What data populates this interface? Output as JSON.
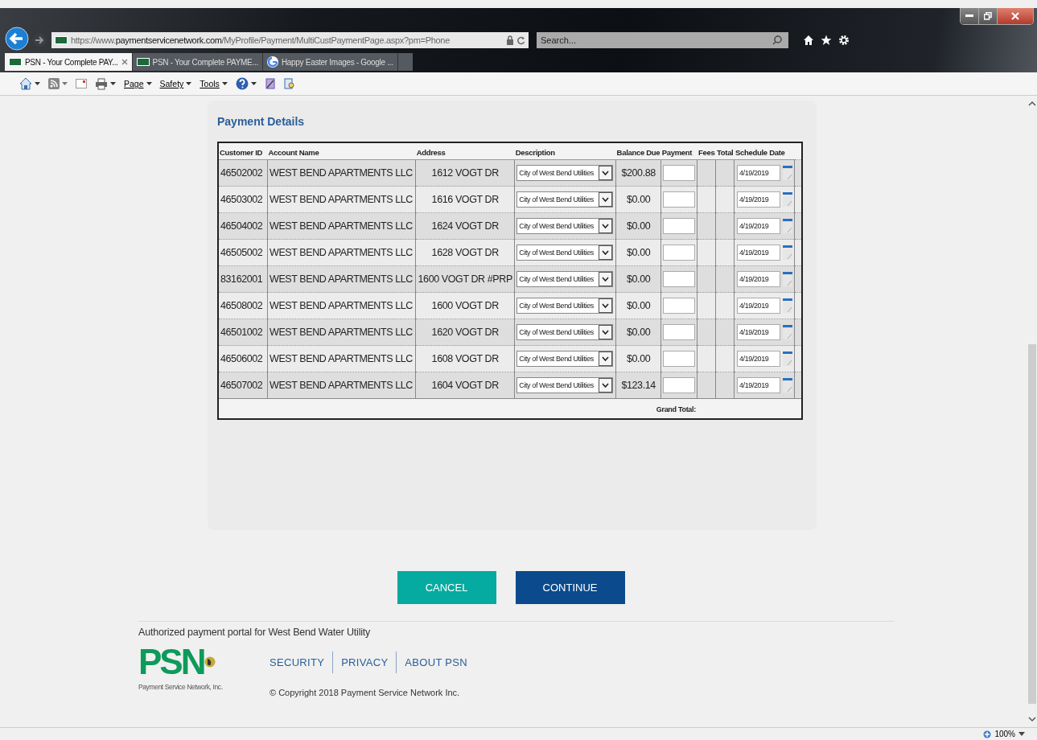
{
  "browser": {
    "address": "https://www.**paymentservicenetwork.com**/MyProfile/Payment/MultiCustPaymentPage.aspx?pm=Phone",
    "search": {
      "placeholder": "Search..."
    },
    "tabs": [
      {
        "title": "PSN - Your Complete PAY...",
        "selected": true
      },
      {
        "title": "PSN - Your Complete PAYME...",
        "selected": false
      },
      {
        "title": "Happy Easter Images - Google ...",
        "selected": false
      }
    ],
    "command_bar": [
      "Page",
      "Safety",
      "Tools"
    ],
    "zoom": "100%"
  },
  "payment_details": {
    "title": "Payment Details",
    "columns": [
      "Customer ID",
      "Account Name",
      "Address",
      "Description",
      "Balance Due",
      "Payment",
      "Fees",
      "Total",
      "Schedule Date"
    ],
    "rows": [
      {
        "customer_id": "46502002",
        "account_name": "WEST BEND APARTMENTS LLC",
        "address": "1612 VOGT DR",
        "description": "City of West Bend Utilities",
        "balance_due": "$200.88",
        "schedule_date": "4/19/2019"
      },
      {
        "customer_id": "46503002",
        "account_name": "WEST BEND APARTMENTS LLC",
        "address": "1616 VOGT DR",
        "description": "City of West Bend Utilities",
        "balance_due": "$0.00",
        "schedule_date": "4/19/2019"
      },
      {
        "customer_id": "46504002",
        "account_name": "WEST BEND APARTMENTS LLC",
        "address": "1624 VOGT DR",
        "description": "City of West Bend Utilities",
        "balance_due": "$0.00",
        "schedule_date": "4/19/2019"
      },
      {
        "customer_id": "46505002",
        "account_name": "WEST BEND APARTMENTS LLC",
        "address": "1628 VOGT DR",
        "description": "City of West Bend Utilities",
        "balance_due": "$0.00",
        "schedule_date": "4/19/2019"
      },
      {
        "customer_id": "83162001",
        "account_name": "WEST BEND APARTMENTS LLC",
        "address": "1600 VOGT DR #PRP",
        "description": "City of West Bend Utilities",
        "balance_due": "$0.00",
        "schedule_date": "4/19/2019"
      },
      {
        "customer_id": "46508002",
        "account_name": "WEST BEND APARTMENTS LLC",
        "address": "1600 VOGT DR",
        "description": "City of West Bend Utilities",
        "balance_due": "$0.00",
        "schedule_date": "4/19/2019"
      },
      {
        "customer_id": "46501002",
        "account_name": "WEST BEND APARTMENTS LLC",
        "address": "1620 VOGT DR",
        "description": "City of West Bend Utilities",
        "balance_due": "$0.00",
        "schedule_date": "4/19/2019"
      },
      {
        "customer_id": "46506002",
        "account_name": "WEST BEND APARTMENTS LLC",
        "address": "1608 VOGT DR",
        "description": "City of West Bend Utilities",
        "balance_due": "$0.00",
        "schedule_date": "4/19/2019"
      },
      {
        "customer_id": "46507002",
        "account_name": "WEST BEND APARTMENTS LLC",
        "address": "1604 VOGT DR",
        "description": "City of West Bend Utilities",
        "balance_due": "$123.14",
        "schedule_date": "4/19/2019"
      }
    ],
    "grand_total_label": "Grand Total:"
  },
  "buttons": [
    {
      "label": "CANCEL",
      "kind": "secondary"
    },
    {
      "label": "CONTINUE",
      "kind": "primary"
    }
  ],
  "footer": {
    "authorized": "Authorized payment portal for West Bend Water Utility",
    "logo_text": "PSN",
    "logo_caption": "Payment Service Network, Inc.",
    "links": [
      "SECURITY",
      "PRIVACY",
      "ABOUT PSN"
    ],
    "copyright": "© Copyright 2018 Payment Service Network Inc."
  }
}
